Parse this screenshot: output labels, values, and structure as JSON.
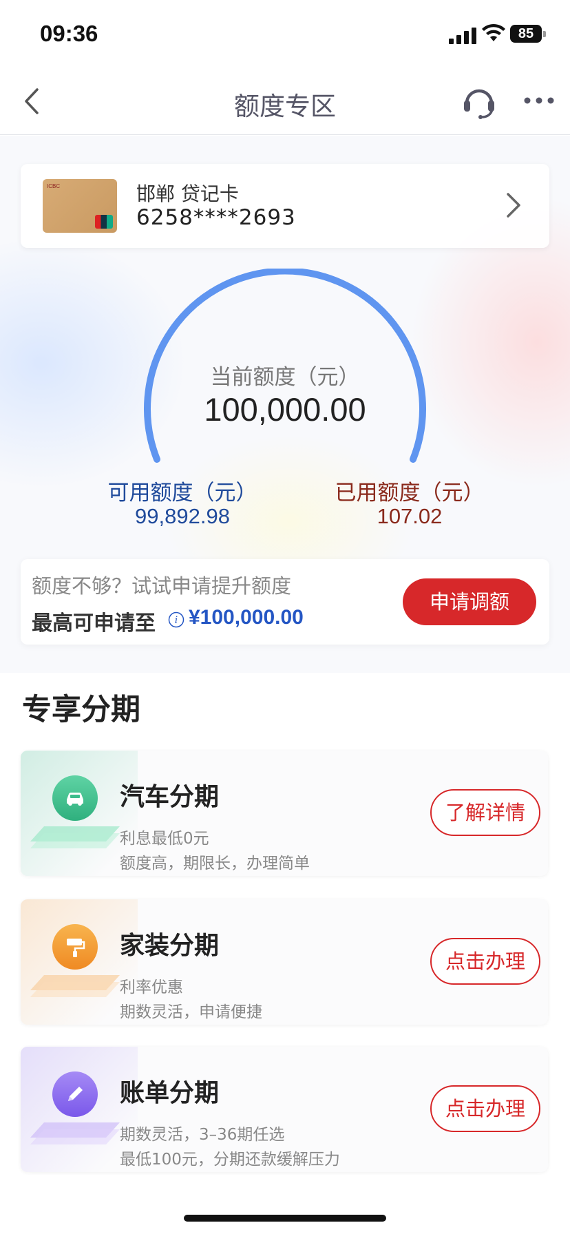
{
  "status_bar": {
    "time": "09:36",
    "battery": "85"
  },
  "nav": {
    "title": "额度专区"
  },
  "card": {
    "name": "邯郸 贷记卡",
    "number": "6258****2693"
  },
  "gauge": {
    "current_label": "当前额度（元）",
    "current_value": "100,000.00",
    "available_label": "可用额度（元）",
    "available_value": "99,892.98",
    "used_label": "已用额度（元）",
    "used_value": "107.02"
  },
  "raise": {
    "hint": "额度不够？试试申请提升额度",
    "max_label": "最高可申请至",
    "max_amount": "¥100,000.00",
    "button": "申请调额"
  },
  "section": {
    "title": "专享分期"
  },
  "installments": [
    {
      "title": "汽车分期",
      "line1": "利息最低0元",
      "line2": "额度高，期限长，办理简单",
      "button": "了解详情",
      "icon": "car-icon",
      "color": "#3dbd8c"
    },
    {
      "title": "家装分期",
      "line1": "利率优惠",
      "line2": "期数灵活，申请便捷",
      "button": "点击办理",
      "icon": "paint-roller-icon",
      "color": "#f29a35"
    },
    {
      "title": "账单分期",
      "line1": "期数灵活，3–36期任选",
      "line2": "最低100元，分期还款缓解压力",
      "button": "点击办理",
      "icon": "pencil-icon",
      "color": "#8b6cf0"
    }
  ],
  "colors": {
    "accent_red": "#d7282a",
    "gauge_blue": "#5f95f0",
    "available_blue": "#1f4a9b",
    "used_red": "#8a2a1c"
  }
}
